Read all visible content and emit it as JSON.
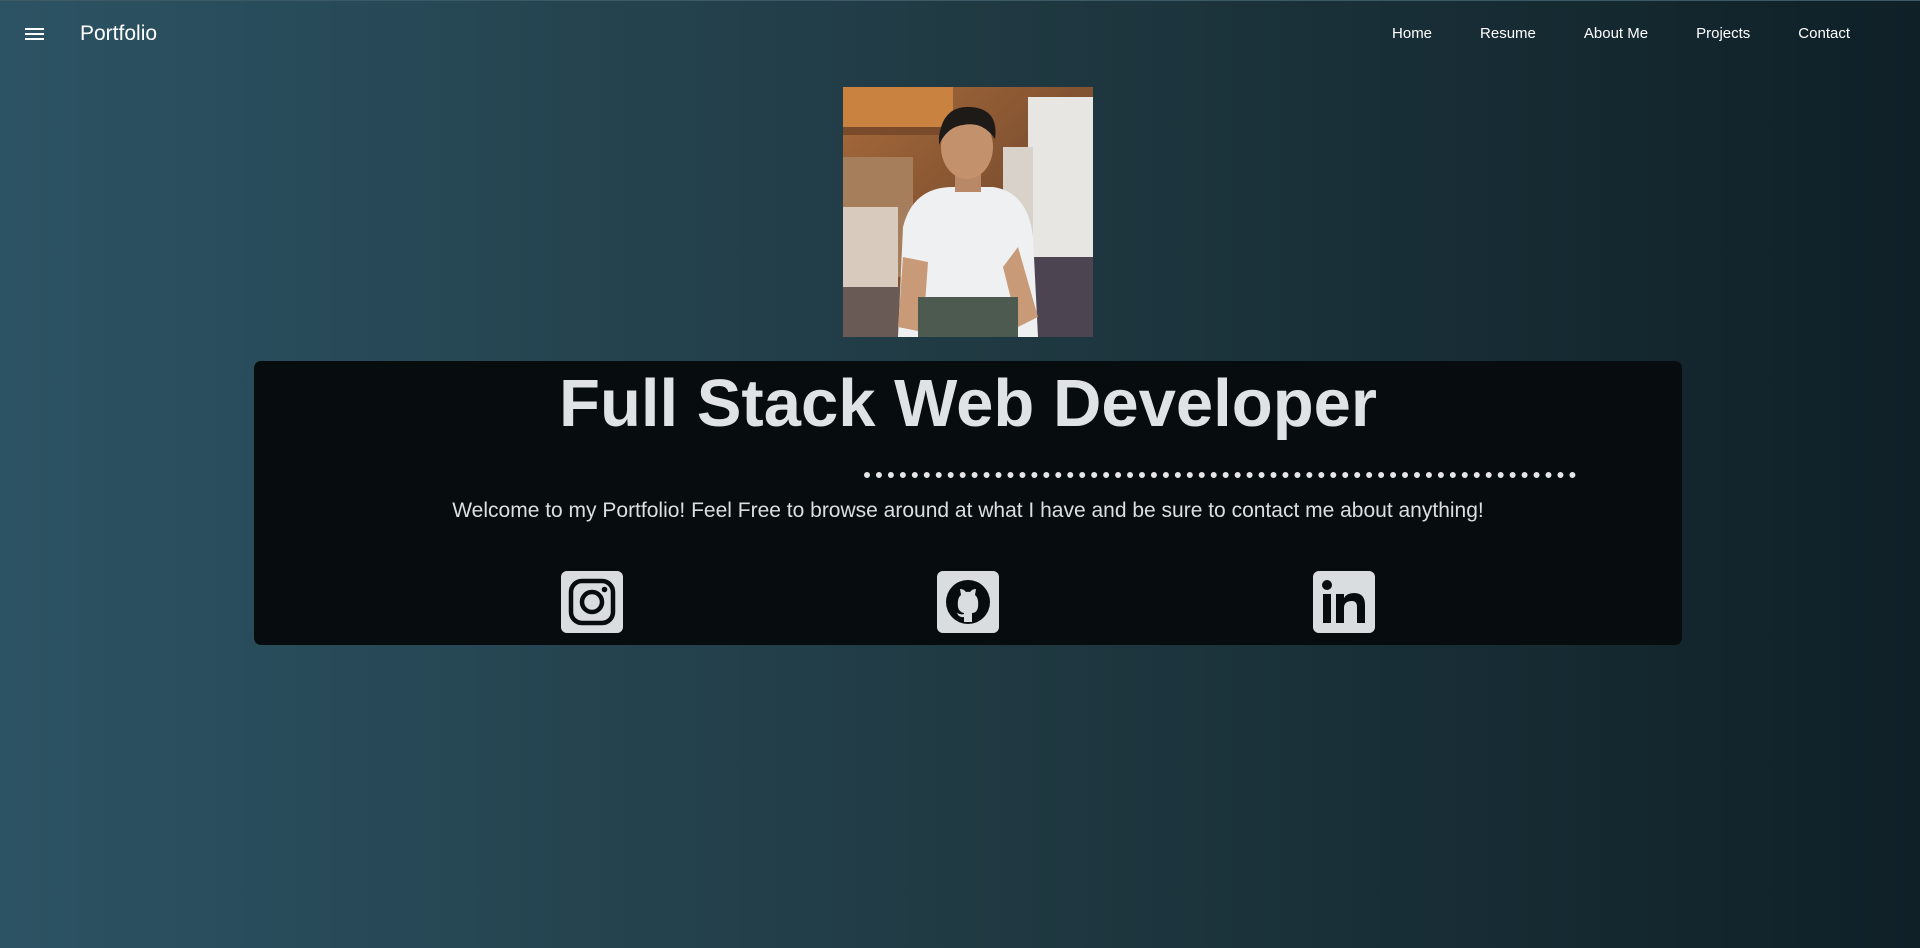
{
  "nav": {
    "brand": "Portfolio",
    "menu_icon": "hamburger-menu-icon",
    "links": [
      {
        "label": "Home"
      },
      {
        "label": "Resume"
      },
      {
        "label": "About Me"
      },
      {
        "label": "Projects"
      },
      {
        "label": "Contact"
      }
    ]
  },
  "hero": {
    "title": "Full Stack Web Developer",
    "tagline": "Welcome to my Portfolio! Feel Free to browse around at what I have and be sure to contact me about anything!"
  },
  "social": [
    {
      "icon": "instagram-icon"
    },
    {
      "icon": "github-icon"
    },
    {
      "icon": "linkedin-icon"
    }
  ],
  "colors": {
    "background_start": "#2c5364",
    "background_end": "#0f2027",
    "card": "#070c0f",
    "icon_tile": "#d9dde0"
  }
}
